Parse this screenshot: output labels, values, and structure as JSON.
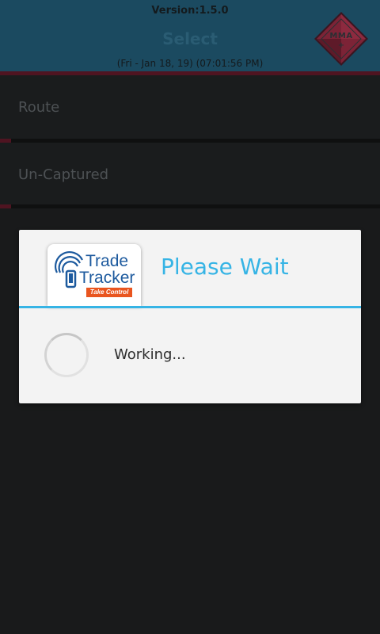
{
  "header": {
    "version": "Version:1.5.0",
    "title": "Select",
    "timestamp": "(Fri - Jan 18, 19) (07:01:56 PM)",
    "logo": {
      "icon": "mma-diamond-logo",
      "text": "MMA",
      "plus": "+"
    }
  },
  "menu": {
    "items": [
      {
        "label": "Route"
      },
      {
        "label": "Un-Captured"
      }
    ]
  },
  "dialog": {
    "brand": {
      "icon": "phone-signal-icon",
      "line1": "Trade",
      "line2": "Tracker",
      "tagline": "Take Control"
    },
    "title": "Please Wait",
    "message": "Working...",
    "spinner_icon": "loading-spinner"
  },
  "colors": {
    "header_bg": "#1b4a60",
    "accent_red": "#4f1421",
    "dialog_accent": "#36b4e5",
    "brand_blue": "#1d5a9e",
    "brand_orange": "#e9551f"
  }
}
